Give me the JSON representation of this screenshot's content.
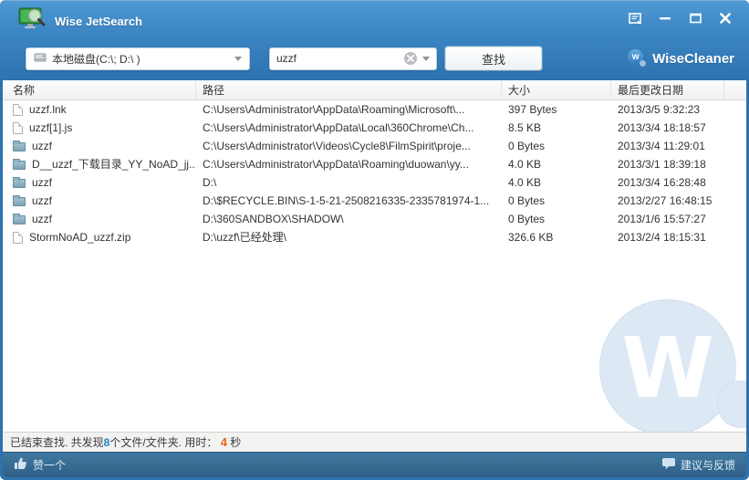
{
  "window": {
    "title": "Wise JetSearch"
  },
  "toolbar": {
    "drive_selector_value": "本地磁盘(C:\\; D:\\ )",
    "search_value": "uzzf",
    "search_button_label": "查找",
    "brand_initial": "w",
    "brand_name": "WiseCleaner"
  },
  "table": {
    "columns": [
      "名称",
      "路径",
      "大小",
      "最后更改日期"
    ],
    "rows": [
      {
        "icon": "file",
        "name": "uzzf.lnk",
        "path": "C:\\Users\\Administrator\\AppData\\Roaming\\Microsoft\\...",
        "size": "397 Bytes",
        "modified": "2013/3/5 9:32:23"
      },
      {
        "icon": "file",
        "name": "uzzf[1].js",
        "path": "C:\\Users\\Administrator\\AppData\\Local\\360Chrome\\Ch...",
        "size": "8.5 KB",
        "modified": "2013/3/4 18:18:57"
      },
      {
        "icon": "folder",
        "name": "uzzf",
        "path": "C:\\Users\\Administrator\\Videos\\Cycle8\\FilmSpirit\\proje...",
        "size": "0 Bytes",
        "modified": "2013/3/4 11:29:01"
      },
      {
        "icon": "folder",
        "name": "D__uzzf_下载目录_YY_NoAD_jj...",
        "path": "C:\\Users\\Administrator\\AppData\\Roaming\\duowan\\yy...",
        "size": "4.0 KB",
        "modified": "2013/3/1 18:39:18"
      },
      {
        "icon": "folder",
        "name": "uzzf",
        "path": "D:\\",
        "size": "4.0 KB",
        "modified": "2013/3/4 16:28:48"
      },
      {
        "icon": "folder",
        "name": "uzzf",
        "path": "D:\\$RECYCLE.BIN\\S-1-5-21-2508216335-2335781974-1...",
        "size": "0 Bytes",
        "modified": "2013/2/27 16:48:15"
      },
      {
        "icon": "folder",
        "name": "uzzf",
        "path": "D:\\360SANDBOX\\SHADOW\\",
        "size": "0 Bytes",
        "modified": "2013/1/6 15:57:27"
      },
      {
        "icon": "file",
        "name": "StormNoAD_uzzf.zip",
        "path": "D:\\uzzf\\已经处理\\",
        "size": "326.6 KB",
        "modified": "2013/2/4 18:15:31"
      }
    ]
  },
  "status": {
    "part1": "已结束查找. 共发现",
    "count": "8",
    "part2": "个文件/文件夹. 用时： ",
    "time": "4",
    "part3": " 秒"
  },
  "footer": {
    "like_label": "赞一个",
    "feedback_label": "建议与反馈"
  },
  "watermark": {
    "letter": "W"
  },
  "colors": {
    "titlebar_blue": "#3c86c4",
    "footer_blue": "#38709a",
    "count_blue": "#1b82c8",
    "time_orange": "#e8650d",
    "watermark_blue": "#dde8f5"
  }
}
